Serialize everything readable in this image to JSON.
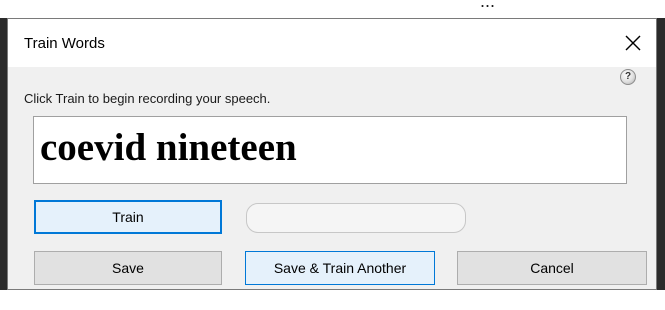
{
  "background_fragment": "...",
  "dialog": {
    "title": "Train Words",
    "close_glyph": "×",
    "help_glyph": "?",
    "instructions": "Click Train to begin recording your speech.",
    "word": "coevid nineteen",
    "progress_fraction": 0.0
  },
  "buttons": {
    "train": "Train",
    "save": "Save",
    "save_train_another": "Save & Train Another",
    "cancel": "Cancel"
  },
  "icons": {
    "close": "close-icon",
    "help": "help-icon"
  },
  "colors": {
    "accent": "#0078d7",
    "dialog_bg": "#f0f0f0",
    "button_bg": "#e1e1e1",
    "button_hover_bg": "#e5f1fb"
  }
}
